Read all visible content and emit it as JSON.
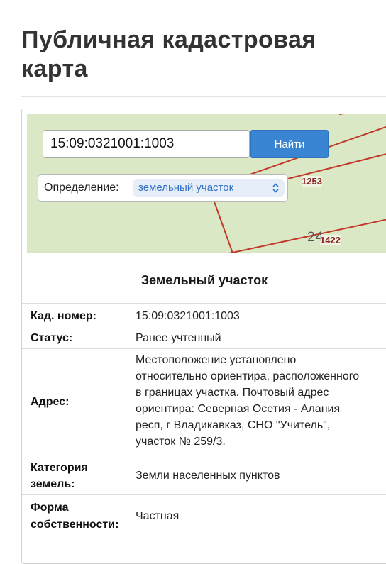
{
  "page": {
    "title": "Публичная кадастровая карта"
  },
  "search": {
    "value": "15:09:0321001:1003",
    "button_label": "Найти"
  },
  "definition": {
    "label": "Определение:",
    "value": "земельный участок"
  },
  "map": {
    "parcel_labels": [
      "1253",
      "1422"
    ],
    "partial_label": "24"
  },
  "info": {
    "title": "Земельный участок",
    "rows": [
      {
        "key": "Кад. номер:",
        "value": "15:09:0321001:1003"
      },
      {
        "key": "Статус:",
        "value": "Ранее учтенный"
      },
      {
        "key": "Адрес:",
        "value_lines": [
          "Местоположение установлено",
          "относительно ориентира, расположенного",
          "в границах участка. Почтовый адрес",
          "ориентира: Северная Осетия - Алания",
          "респ, г Владикавказ, СНО \"Учитель\",",
          "участок № 259/3."
        ]
      },
      {
        "key_lines": [
          "Категория",
          "земель:"
        ],
        "value": "Земли населенных пунктов"
      },
      {
        "key_lines": [
          "Форма",
          "собственности:"
        ],
        "value": "Частная"
      }
    ]
  },
  "colors": {
    "map_background": "#dbe8c5",
    "parcel_border": "#c0392b",
    "button": "#3a85d3",
    "select_text": "#2f6fc4"
  }
}
